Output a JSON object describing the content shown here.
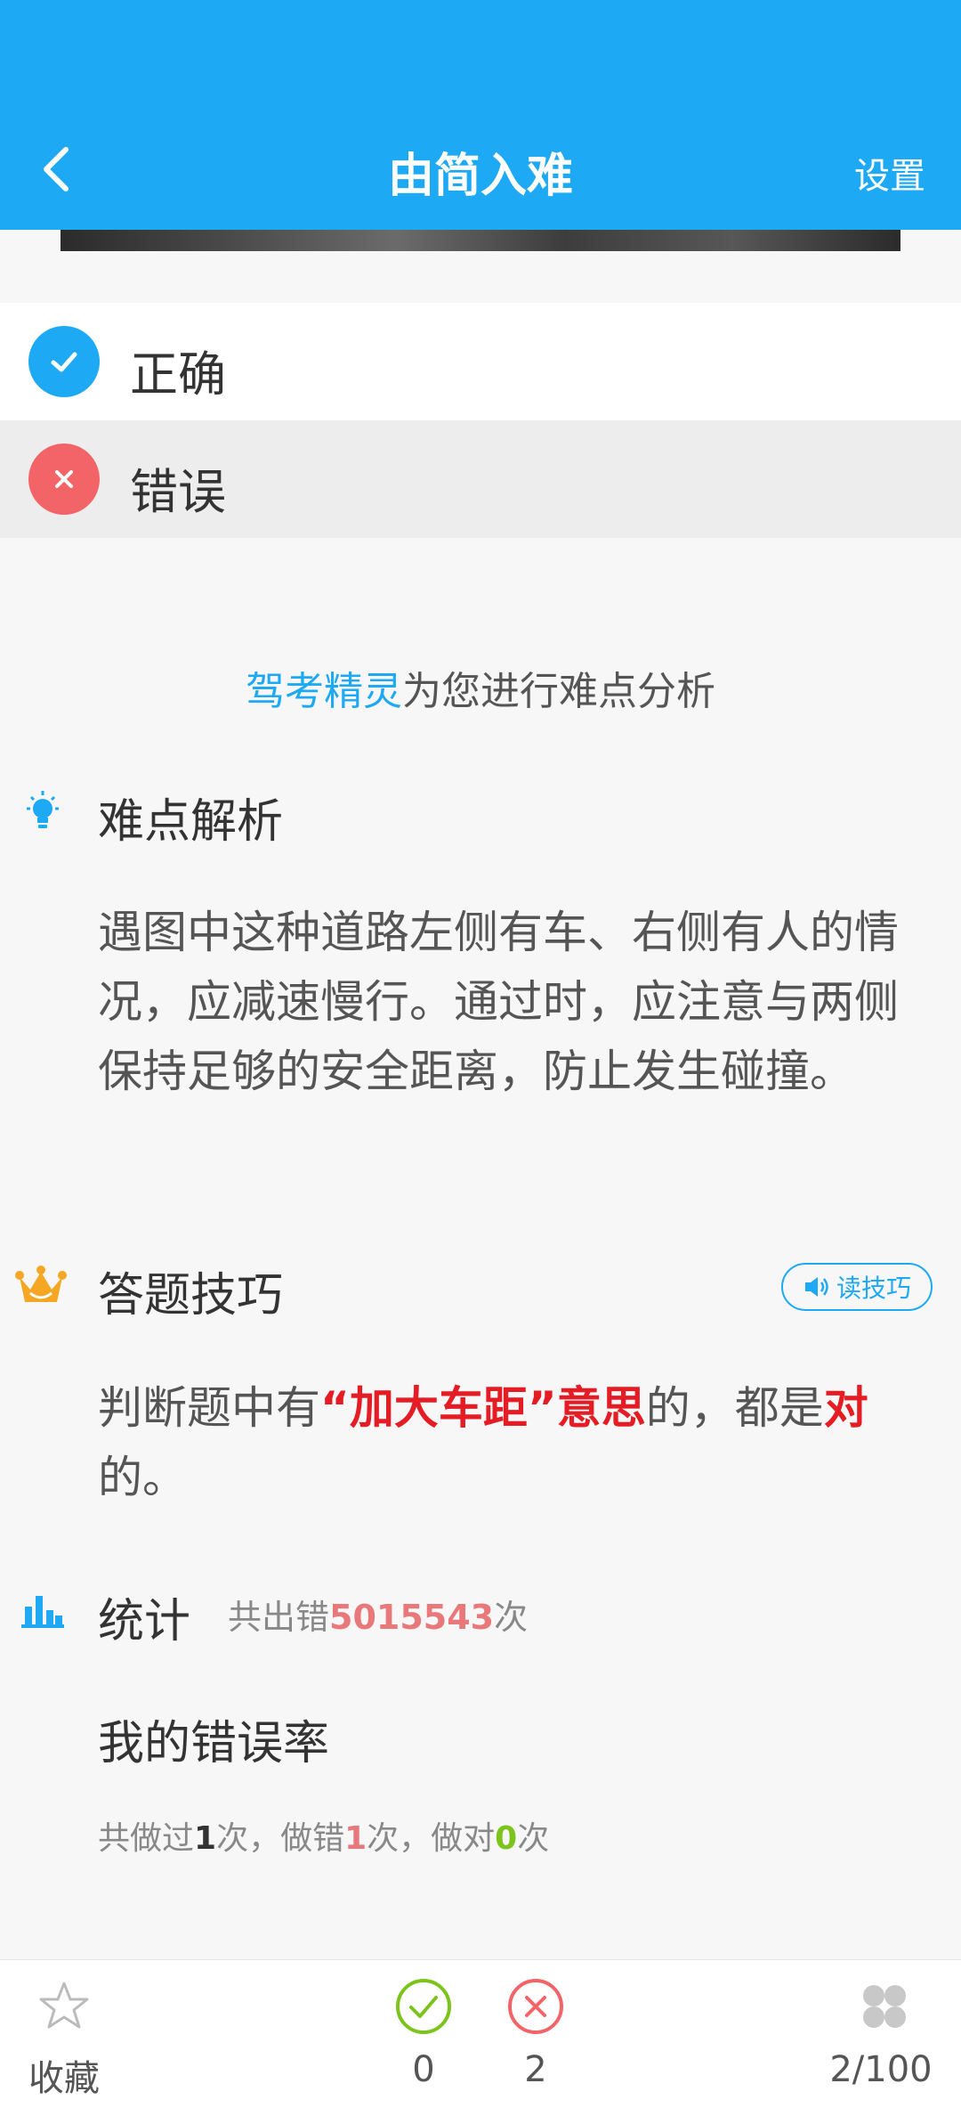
{
  "header": {
    "title": "由简入难",
    "settings_label": "设置"
  },
  "options": [
    {
      "label": "正确",
      "state": "selected-correct"
    },
    {
      "label": "错误",
      "state": "wrong"
    }
  ],
  "analysis_intro": {
    "brand": "驾考精灵",
    "text": "为您进行难点分析"
  },
  "difficulty": {
    "title": "难点解析",
    "body": "遇图中这种道路左侧有车、右侧有人的情况，应减速慢行。通过时，应注意与两侧保持足够的安全距离，防止发生碰撞。"
  },
  "tips": {
    "title": "答题技巧",
    "read_button": "读技巧",
    "body_prefix": "判断题中有",
    "highlight": "“加大车距”意思",
    "body_middle": "的，都是",
    "highlight2": "对",
    "body_suffix": "的。"
  },
  "stats": {
    "title": "统计",
    "total_prefix": "共出错",
    "total_count": "5015543",
    "total_suffix": "次",
    "my_rate_title": "我的错误率",
    "done_prefix": "共做过",
    "done_count": "1",
    "wrong_prefix": "次，做错",
    "wrong_count": "1",
    "right_prefix": "次，做对",
    "right_count": "0",
    "right_suffix": "次"
  },
  "bottom_bar": {
    "favorite_label": "收藏",
    "correct_count": "0",
    "wrong_count": "2",
    "progress": "2/100"
  },
  "colors": {
    "primary": "#1ea9f5",
    "wrong": "#f26468",
    "highlight": "#e51c23",
    "success": "#7cc41b"
  }
}
